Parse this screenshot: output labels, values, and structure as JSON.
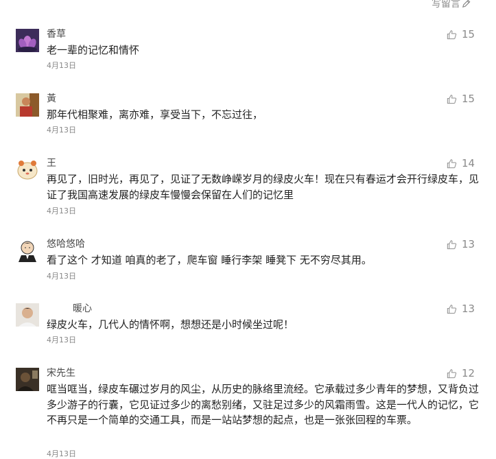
{
  "header": {
    "write_label": "写留言"
  },
  "colors": {
    "accent": "#576b95",
    "icon_gray": "#9a9a9a",
    "text": "#222222",
    "date": "#888888"
  },
  "comments": [
    {
      "name": "香草",
      "text": "老一辈的记忆和情怀",
      "date": "4月13日",
      "likes": "15",
      "avatar": "lotus-avatar"
    },
    {
      "name": "黃",
      "text": "那年代相聚难，离亦难，享受当下，不忘过往，",
      "date": "4月13日",
      "likes": "15",
      "avatar": "portrait-avatar"
    },
    {
      "name": "王",
      "text": "再见了，旧时光，再见了，见证了无数峥嵘岁月的绿皮火车！现在只有春运才会开行绿皮车，见证了我国高速发展的绿皮车慢慢会保留在人们的记忆里",
      "date": "4月13日",
      "likes": "14",
      "avatar": "hamster-avatar"
    },
    {
      "name": "悠哈悠哈",
      "text": "看了这个 才知道 咱真的老了，爬车窗 睡行李架 睡凳下 无不穷尽其用。",
      "date": "4月13日",
      "likes": "13",
      "avatar": "cartoon-man-avatar"
    },
    {
      "name": "暖心",
      "text": "绿皮火车，几代人的情怀啊，想想还是小时候坐过呢！",
      "date": "4月13日",
      "likes": "13",
      "avatar": "young-man-avatar"
    },
    {
      "name": "宋先生",
      "text": "哐当哐当，绿皮车碾过岁月的风尘，从历史的脉络里流经。它承载过多少青年的梦想，又背负过多少游子的行囊，它见证过多少的离愁别绪，又驻足过多少的风霜雨雪。这是一代人的记忆，它不再只是一个简单的交通工具，而是一站站梦想的起点，也是一张张回程的车票。",
      "date": "4月13日",
      "likes": "12",
      "avatar": "dark-photo-avatar"
    }
  ]
}
